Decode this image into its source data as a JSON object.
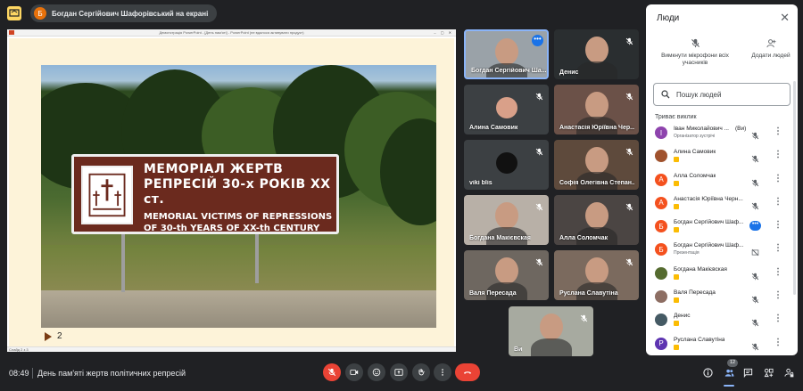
{
  "banner": {
    "presenter_initial": "Б",
    "presenting_text": "Богдан Сергійович Шафорівський на екрані"
  },
  "slide": {
    "window_title": "Демонстрація PowerPoint - [День пам'яті] - PowerPoint (не вдалося активувати продукт)",
    "sign_line1": "МЕМОРІАЛ ЖЕРТВ",
    "sign_line2": "РЕПРЕСІЙ 30-х РОКІВ XX ст.",
    "sign_line3": "MEMORIAL VICTIMS OF REPRESSIONS",
    "sign_line4": "OF 30-th YEARS OF XX-th CENTURY",
    "slide_number": "2",
    "status_text": "Слайд 2 з 3"
  },
  "tiles": [
    {
      "name": "Богдан Сергійович Ша...",
      "mic": "dots",
      "kind": "video",
      "bg": "#9aa2a8"
    },
    {
      "name": "Денис",
      "mic": "off",
      "kind": "video",
      "bg": "#2a2e30"
    },
    {
      "name": "Алина Самовик",
      "mic": "off",
      "kind": "avatar",
      "bg": "#3c4043",
      "avatar_bg": "#d9a089"
    },
    {
      "name": "Анастасія Юріївна Чер...",
      "mic": "off",
      "kind": "video",
      "bg": "#6b5148"
    },
    {
      "name": "viki blis",
      "mic": "off",
      "kind": "avatar",
      "bg": "#3c4043",
      "avatar_bg": "#111"
    },
    {
      "name": "Софія Олегівна Степан...",
      "mic": "off",
      "kind": "video",
      "bg": "#5e4a3c"
    },
    {
      "name": "Богдана Макієвская",
      "mic": "off",
      "kind": "video",
      "bg": "#b8b0a7"
    },
    {
      "name": "Алла Соломчак",
      "mic": "off",
      "kind": "video",
      "bg": "#4b4543"
    },
    {
      "name": "Валя Пересада",
      "mic": "off",
      "kind": "video",
      "bg": "#6e6760"
    },
    {
      "name": "Руслана Славутіна",
      "mic": "off",
      "kind": "video",
      "bg": "#7b6a5e"
    },
    {
      "name": "Ви",
      "mic": "off",
      "kind": "video",
      "bg": "#a7aaa0"
    }
  ],
  "panel": {
    "title": "Люди",
    "mute_all_label": "Вимкнути мікрофони всіх учасників",
    "add_people_label": "Додати людей",
    "search_placeholder": "Пошук людей",
    "section_label": "Триває виклик",
    "participants": [
      {
        "initial": "І",
        "color": "#8e44ad",
        "name": "Іван Миколайович ...",
        "you": "(Ви)",
        "sub": "Організатор зустрічі",
        "badge": false,
        "control": "mic-off"
      },
      {
        "initial": "",
        "color": "#a0522d",
        "name": "Алина Самовик",
        "you": "",
        "sub": "",
        "badge": true,
        "control": "mic-off"
      },
      {
        "initial": "А",
        "color": "#f4511e",
        "name": "Алла Соломчак",
        "you": "",
        "sub": "",
        "badge": true,
        "control": "mic-off"
      },
      {
        "initial": "А",
        "color": "#f4511e",
        "name": "Анастасія Юріївна Черн...",
        "you": "",
        "sub": "",
        "badge": true,
        "control": "mic-off"
      },
      {
        "initial": "Б",
        "color": "#f4511e",
        "name": "Богдан Сергійович Шаф...",
        "you": "",
        "sub": "",
        "badge": true,
        "control": "dots"
      },
      {
        "initial": "Б",
        "color": "#f4511e",
        "name": "Богдан Сергійович Шаф...",
        "you": "",
        "sub": "Презентація",
        "badge": false,
        "control": "present-off"
      },
      {
        "initial": "",
        "color": "#556b2f",
        "name": "Богдана Макієвская",
        "you": "",
        "sub": "",
        "badge": true,
        "control": "mic-off"
      },
      {
        "initial": "",
        "color": "#8d6e63",
        "name": "Валя Пересада",
        "you": "",
        "sub": "",
        "badge": true,
        "control": "mic-off"
      },
      {
        "initial": "",
        "color": "#455a64",
        "name": "Денис",
        "you": "",
        "sub": "",
        "badge": true,
        "control": "mic-off"
      },
      {
        "initial": "Р",
        "color": "#5e35b1",
        "name": "Руслана Славутіна",
        "you": "",
        "sub": "",
        "badge": true,
        "control": "mic-off"
      }
    ]
  },
  "bottom": {
    "time": "08:49",
    "meeting_title": "День пам'яті жертв політичних репресій",
    "people_count": "12"
  }
}
